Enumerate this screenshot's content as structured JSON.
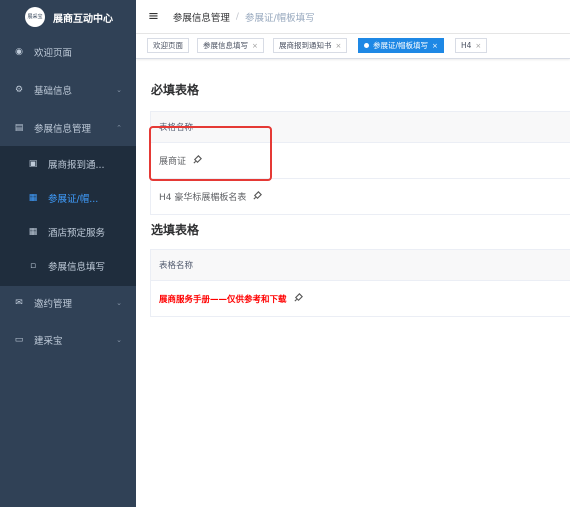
{
  "brand": {
    "title": "展商互动中心",
    "logo_text": "展采宝"
  },
  "sidebar": {
    "items": [
      {
        "label": "欢迎页面",
        "icon": "dashboard-icon"
      },
      {
        "label": "基础信息",
        "icon": "gear-icon"
      },
      {
        "label": "参展信息管理",
        "icon": "clipboard-icon"
      },
      {
        "label": "展商报到通...",
        "icon": "calendar-icon"
      },
      {
        "label": "参展证/帽...",
        "icon": "grid-icon"
      },
      {
        "label": "酒店预定服务",
        "icon": "grid-icon"
      },
      {
        "label": "参展信息填写",
        "icon": "form-icon"
      },
      {
        "label": "邀约管理",
        "icon": "mail-icon"
      },
      {
        "label": "建采宝",
        "icon": "monitor-icon"
      }
    ]
  },
  "header": {
    "breadcrumb": [
      "参展信息管理",
      "参展证/帽板填写"
    ]
  },
  "tags": [
    {
      "label": "欢迎页面",
      "closable": false,
      "active": false
    },
    {
      "label": "参展信息填写",
      "closable": true,
      "active": false
    },
    {
      "label": "展商报到通知书",
      "closable": true,
      "active": false
    },
    {
      "label": "参展证/帽板填写",
      "closable": true,
      "active": true
    },
    {
      "label": "H4",
      "closable": true,
      "active": false
    }
  ],
  "required": {
    "title": "必填表格",
    "header": "表格名称",
    "rows": [
      "展商证",
      "H4 豪华标展楣板名表"
    ]
  },
  "optional": {
    "title": "选填表格",
    "header": "表格名称",
    "rows": [
      "展商服务手册——仅供参考和下载"
    ]
  },
  "colors": {
    "sidebar_bg": "#304156",
    "accent": "#409eff",
    "tag_active": "#1e88e5",
    "highlight": "#e53935"
  }
}
